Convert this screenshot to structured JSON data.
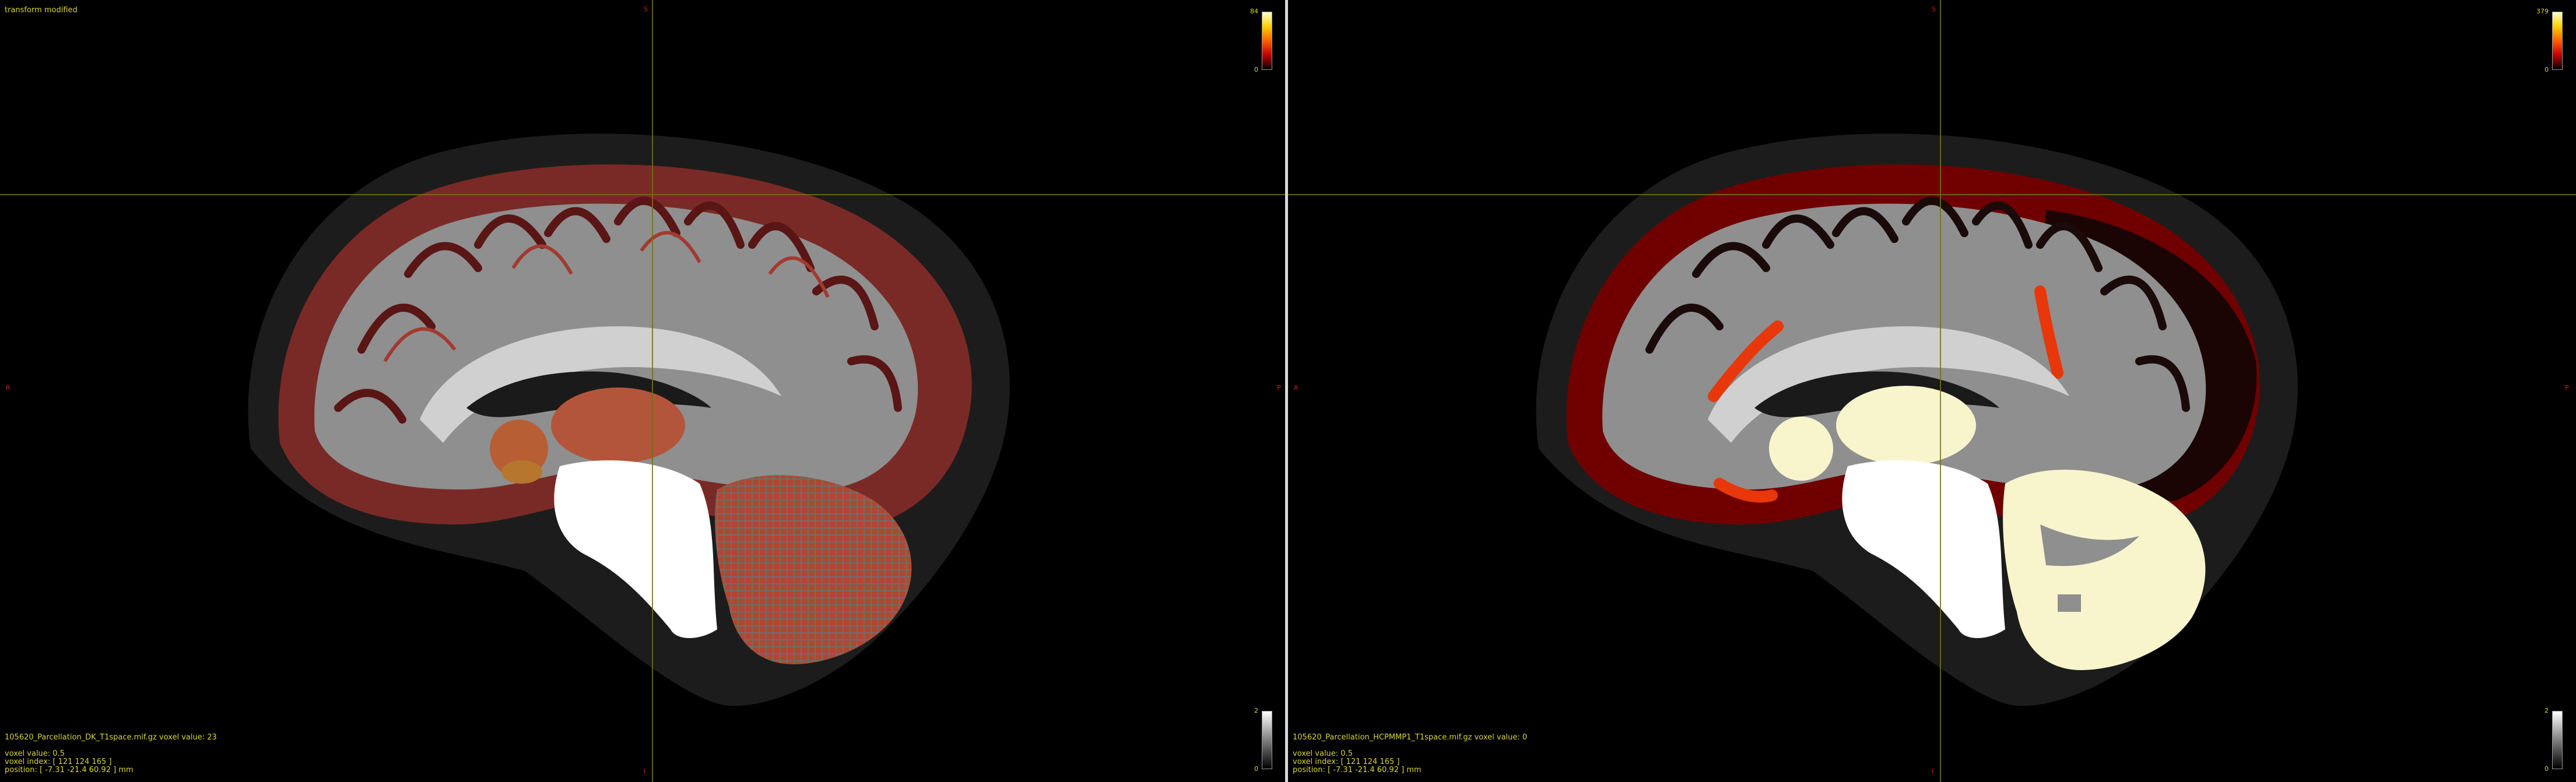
{
  "app": {
    "status": "transform modified"
  },
  "views": [
    {
      "id": "left",
      "orientation": {
        "top": "S",
        "left": "R",
        "right": "P",
        "bottom": "I"
      },
      "overlay_line": "105620_Parcellation_DK_T1space.mif.gz voxel value: 23",
      "voxel_value": "voxel value: 0.5",
      "voxel_index": "voxel index: [ 121 124 165 ]",
      "position": "position: [ -7.31 -21.4 60.92 ] mm",
      "colorbar_top": {
        "max": "84",
        "min": "0"
      },
      "colorbar_bottom": {
        "max": "2",
        "min": "0"
      }
    },
    {
      "id": "right",
      "orientation": {
        "top": "S",
        "left": "A",
        "right": "P",
        "bottom": "I"
      },
      "overlay_line": "105620_Parcellation_HCPMMP1_T1space.mif.gz voxel value: 0",
      "voxel_value": "voxel value: 0.5",
      "voxel_index": "voxel index: [ 121 124 165 ]",
      "position": "position: [ -7.31 -21.4 60.92 ] mm",
      "colorbar_top": {
        "max": "379",
        "min": "0"
      },
      "colorbar_bottom": {
        "max": "2",
        "min": "0"
      }
    }
  ],
  "colors": {
    "hot_colormap": [
      "#000000",
      "#b00000",
      "#ff4000",
      "#ffd000",
      "#ffffff"
    ],
    "gray_colormap": [
      "#000000",
      "#ffffff"
    ],
    "text": "#d9d437",
    "orientation": "#c81e1e"
  }
}
